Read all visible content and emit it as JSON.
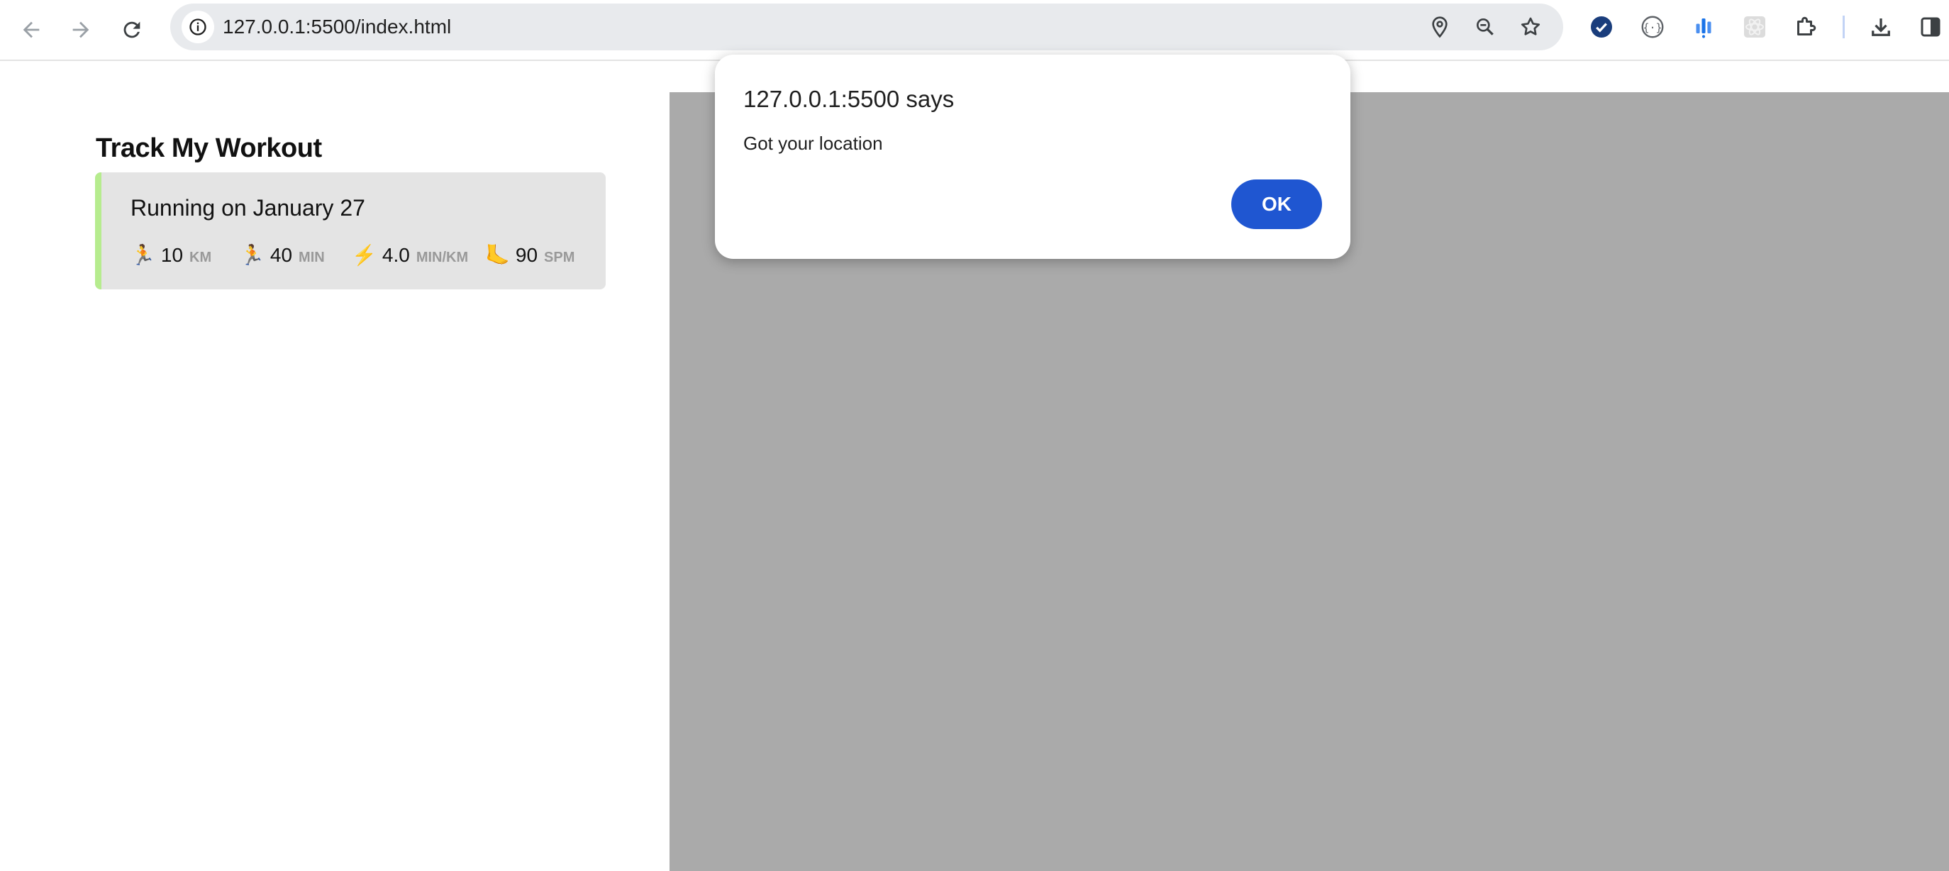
{
  "browser": {
    "url": "127.0.0.1:5500/index.html"
  },
  "sidebar": {
    "title": "Track My Workout",
    "workout": {
      "title": "Running on January 27",
      "accent_color": "#b6ec8e",
      "stats": [
        {
          "icon": "🏃",
          "value": "10",
          "unit": "KM"
        },
        {
          "icon": "🏃",
          "value": "40",
          "unit": "MIN"
        },
        {
          "icon": "⚡",
          "value": "4.0",
          "unit": "MIN/KM"
        },
        {
          "icon": "🦶",
          "value": "90",
          "unit": "SPM"
        }
      ]
    }
  },
  "map": {
    "background_color": "#aaaaaa"
  },
  "dialog": {
    "title": "127.0.0.1:5500 says",
    "message": "Got your location",
    "ok_label": "OK",
    "ok_color": "#1f56d1"
  }
}
